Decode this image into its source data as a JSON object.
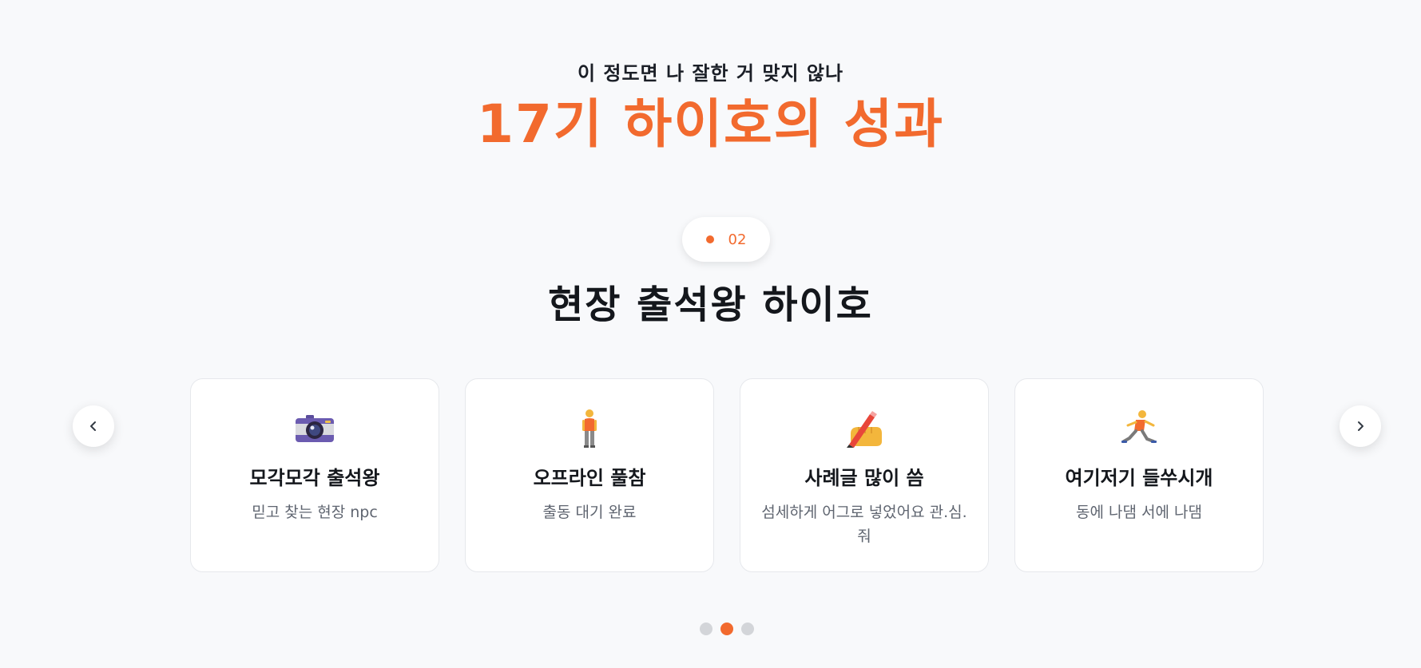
{
  "header": {
    "subtitle": "이 정도면 나 잘한 거 맞지 않나",
    "title": "17기 하이호의 성과"
  },
  "section": {
    "step_number": "02",
    "title": "현장 출석왕 하이호"
  },
  "cards": [
    {
      "icon": "camera-icon",
      "title": "모각모각 출석왕",
      "description": "믿고 찾는 현장 npc"
    },
    {
      "icon": "standing-person-icon",
      "title": "오프라인 풀참",
      "description": "출동 대기 완료"
    },
    {
      "icon": "writing-hand-icon",
      "title": "사례글 많이 씀",
      "description": "섬세하게 어그로 넣었어요 관.심.줘"
    },
    {
      "icon": "running-person-icon",
      "title": "여기저기 들쑤시개",
      "description": "동에 나댐 서에 나댐"
    }
  ],
  "carousel": {
    "prev_icon": "chevron-left-icon",
    "next_icon": "chevron-right-icon",
    "page_count": 3,
    "active_index": 1
  },
  "colors": {
    "accent": "#f26a2e",
    "background": "#f8f9fb",
    "card_background": "#ffffff",
    "text_dark": "#14171c",
    "text_muted": "#5f6570",
    "dot_inactive": "#d3d5d9"
  }
}
